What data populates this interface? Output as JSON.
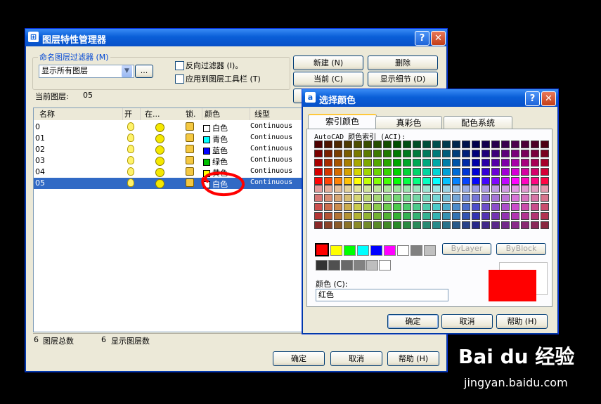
{
  "layer_manager": {
    "title": "图层特性管理器",
    "filter_group": "命名图层过滤器 (M)",
    "filter_value": "显示所有图层",
    "browse_label": "...",
    "invert_filter": "反向过滤器 (I)。",
    "apply_toolbar": "应用到图层工具栏 (T)",
    "btn_new": "新建 (N)",
    "btn_delete": "删除",
    "btn_current": "当前 (C)",
    "btn_details": "显示细节 (D)",
    "current_layer_label": "当前图层:",
    "current_layer_value": "05",
    "columns": {
      "name": "名称",
      "on": "开",
      "freeze": "在...",
      "lock": "锁.",
      "color": "颜色",
      "linetype": "线型"
    },
    "rows": [
      {
        "name": "0",
        "color_name": "白色",
        "swatch": "#ffffff",
        "linetype": "Continuous"
      },
      {
        "name": "01",
        "color_name": "青色",
        "swatch": "#00ffff",
        "linetype": "Continuous"
      },
      {
        "name": "02",
        "color_name": "蓝色",
        "swatch": "#0000ff",
        "linetype": "Continuous"
      },
      {
        "name": "03",
        "color_name": "绿色",
        "swatch": "#00c000",
        "linetype": "Continuous"
      },
      {
        "name": "04",
        "color_name": "黄色",
        "swatch": "#ffff00",
        "linetype": "Continuous"
      },
      {
        "name": "05",
        "color_name": "白色",
        "swatch": "#ffffff",
        "linetype": "Continuous"
      }
    ],
    "total_count": "6",
    "total_label": "图层总数",
    "shown_count": "6",
    "shown_label": "显示图层数",
    "btn_ok": "确定",
    "btn_cancel": "取消",
    "btn_help": "帮助 (H)"
  },
  "color_dialog": {
    "title": "选择颜色",
    "tabs": [
      "索引颜色",
      "真彩色",
      "配色系统"
    ],
    "aci_label": "AutoCAD 颜色索引 (ACI):",
    "bylayer": "ByLayer",
    "byblock": "ByBlock",
    "color_label": "颜色 (C):",
    "color_value": "红色",
    "selected_color": "#ff0000",
    "btn_ok": "确定",
    "btn_cancel": "取消",
    "btn_help": "帮助 (H)"
  },
  "watermark": {
    "brand": "Bai du 经验",
    "url": "jingyan.baidu.com"
  },
  "colors": {
    "accent": "#0a5fd8",
    "selection": "#316ac5",
    "annotation": "#ff0000"
  }
}
